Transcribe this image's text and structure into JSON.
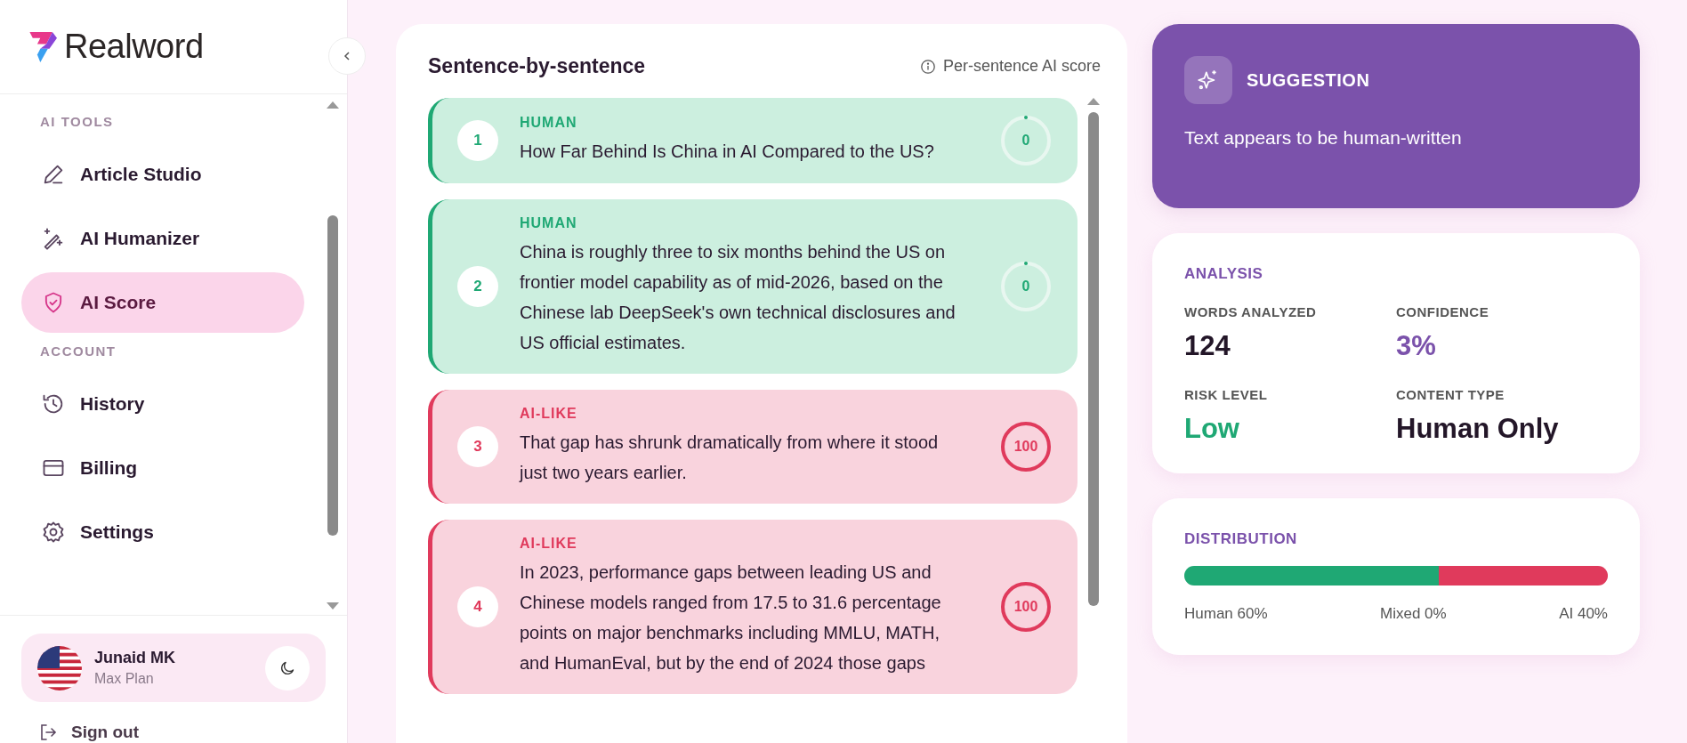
{
  "sidebar": {
    "brand": "Realword",
    "sections": [
      {
        "title": "AI TOOLS",
        "items": [
          {
            "label": "Article Studio",
            "selected": false
          },
          {
            "label": "AI Humanizer",
            "selected": false
          },
          {
            "label": "AI Score",
            "selected": true
          }
        ]
      },
      {
        "title": "ACCOUNT",
        "items": [
          {
            "label": "History",
            "selected": false
          },
          {
            "label": "Billing",
            "selected": false
          },
          {
            "label": "Settings",
            "selected": false
          }
        ]
      }
    ],
    "user": {
      "name": "Junaid MK",
      "plan": "Max Plan"
    },
    "sign_out": "Sign out"
  },
  "sentences": {
    "title": "Sentence-by-sentence",
    "hint": "Per-sentence AI score",
    "items": [
      {
        "number": "1",
        "kind": "human",
        "label": "HUMAN",
        "text": "How Far Behind Is China in AI Compared to the US?",
        "score": "0",
        "level": 0
      },
      {
        "number": "2",
        "kind": "human",
        "label": "HUMAN",
        "text": "China is roughly three to six months behind the US on frontier model capability as of mid-2026, based on the Chinese lab DeepSeek's own technical disclosures and US official estimates.",
        "score": "0",
        "level": 0
      },
      {
        "number": "3",
        "kind": "ai",
        "label": "AI-LIKE",
        "text": "That gap has shrunk dramatically from where it stood just two years earlier.",
        "score": "100",
        "level": 1
      },
      {
        "number": "4",
        "kind": "ai",
        "label": "AI-LIKE",
        "text": "In 2023, performance gaps between leading US and Chinese models ranged from 17.5 to 31.6 percentage points on major benchmarks including MMLU, MATH, and HumanEval, but by the end of 2024 those gaps",
        "score": "100",
        "level": 1
      }
    ]
  },
  "suggestion": {
    "title": "SUGGESTION",
    "text": "Text appears to be human-written"
  },
  "analysis": {
    "title": "ANALYSIS",
    "stats": [
      {
        "label": "WORDS ANALYZED",
        "value": "124",
        "kind": "plain"
      },
      {
        "label": "CONFIDENCE",
        "value": "3%",
        "kind": "accent"
      },
      {
        "label": "RISK LEVEL",
        "value": "Low",
        "kind": "good"
      },
      {
        "label": "CONTENT TYPE",
        "value": "Human Only",
        "kind": "plain"
      }
    ]
  },
  "distribution": {
    "title": "DISTRIBUTION",
    "segments": [
      {
        "label": "Human 60%",
        "level": 0.6,
        "color": "#1fa874"
      },
      {
        "label": "Mixed 0%"
      },
      {
        "label": "AI 40%",
        "level": 0.4,
        "color": "#e03a5c"
      }
    ]
  }
}
